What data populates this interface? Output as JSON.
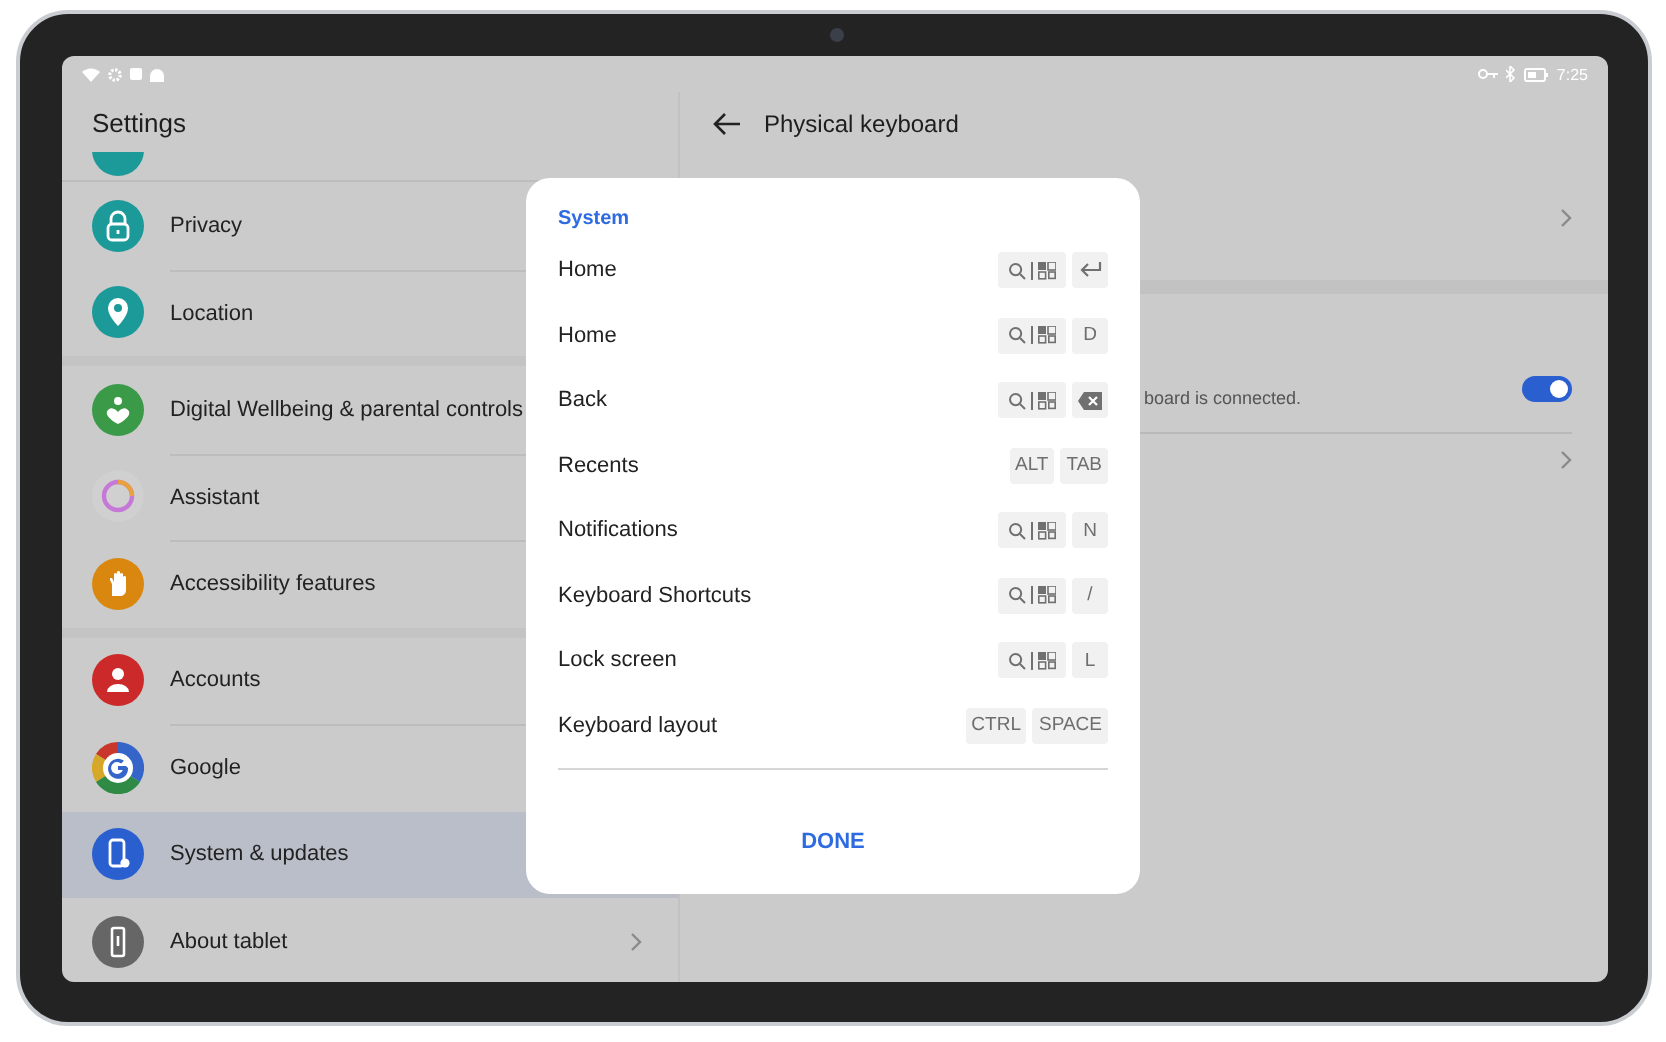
{
  "status_bar": {
    "time": "7:25"
  },
  "sidebar": {
    "title": "Settings",
    "groups": [
      {
        "items": [
          {
            "label": "Privacy",
            "kind": "lock",
            "color": "#1c9a9a",
            "selected": false
          },
          {
            "label": "Location",
            "kind": "pin",
            "color": "#1c9a9a",
            "selected": false
          }
        ]
      },
      {
        "items": [
          {
            "label": "Digital Wellbeing & parental controls",
            "kind": "heart",
            "color": "#3a9a48",
            "selected": false
          },
          {
            "label": "Assistant",
            "kind": "ring",
            "selected": false
          },
          {
            "label": "Accessibility features",
            "kind": "hand",
            "color": "#d9870f",
            "selected": false
          }
        ]
      },
      {
        "items": [
          {
            "label": "Accounts",
            "kind": "person",
            "color": "#cc2a2a",
            "selected": false
          },
          {
            "label": "Google",
            "kind": "google",
            "selected": false
          },
          {
            "label": "System & updates",
            "kind": "phone",
            "color": "#2a5fd0",
            "selected": true
          },
          {
            "label": "About tablet",
            "kind": "info",
            "color": "#666666",
            "selected": false,
            "chevron": true
          }
        ]
      }
    ]
  },
  "detail": {
    "title": "Physical keyboard",
    "subtitle": "board is connected.",
    "toggle": {
      "on": true
    }
  },
  "dialog": {
    "title": "System",
    "shortcuts": [
      {
        "label": "Home",
        "keys": [
          {
            "kind": "meta"
          },
          {
            "kind": "enter"
          }
        ]
      },
      {
        "label": "Home",
        "keys": [
          {
            "kind": "meta"
          },
          {
            "kind": "text",
            "label": "D"
          }
        ]
      },
      {
        "label": "Back",
        "keys": [
          {
            "kind": "meta"
          },
          {
            "kind": "backspace"
          }
        ]
      },
      {
        "label": "Recents",
        "keys": [
          {
            "kind": "text",
            "label": "ALT"
          },
          {
            "kind": "text",
            "label": "TAB"
          }
        ]
      },
      {
        "label": "Notifications",
        "keys": [
          {
            "kind": "meta"
          },
          {
            "kind": "text",
            "label": "N"
          }
        ]
      },
      {
        "label": "Keyboard Shortcuts",
        "keys": [
          {
            "kind": "meta"
          },
          {
            "kind": "text",
            "label": "/"
          }
        ]
      },
      {
        "label": "Lock screen",
        "keys": [
          {
            "kind": "meta"
          },
          {
            "kind": "text",
            "label": "L"
          }
        ]
      },
      {
        "label": "Keyboard layout",
        "keys": [
          {
            "kind": "text",
            "label": "CTRL"
          },
          {
            "kind": "text",
            "label": "SPACE"
          }
        ]
      }
    ],
    "button": "DONE"
  }
}
